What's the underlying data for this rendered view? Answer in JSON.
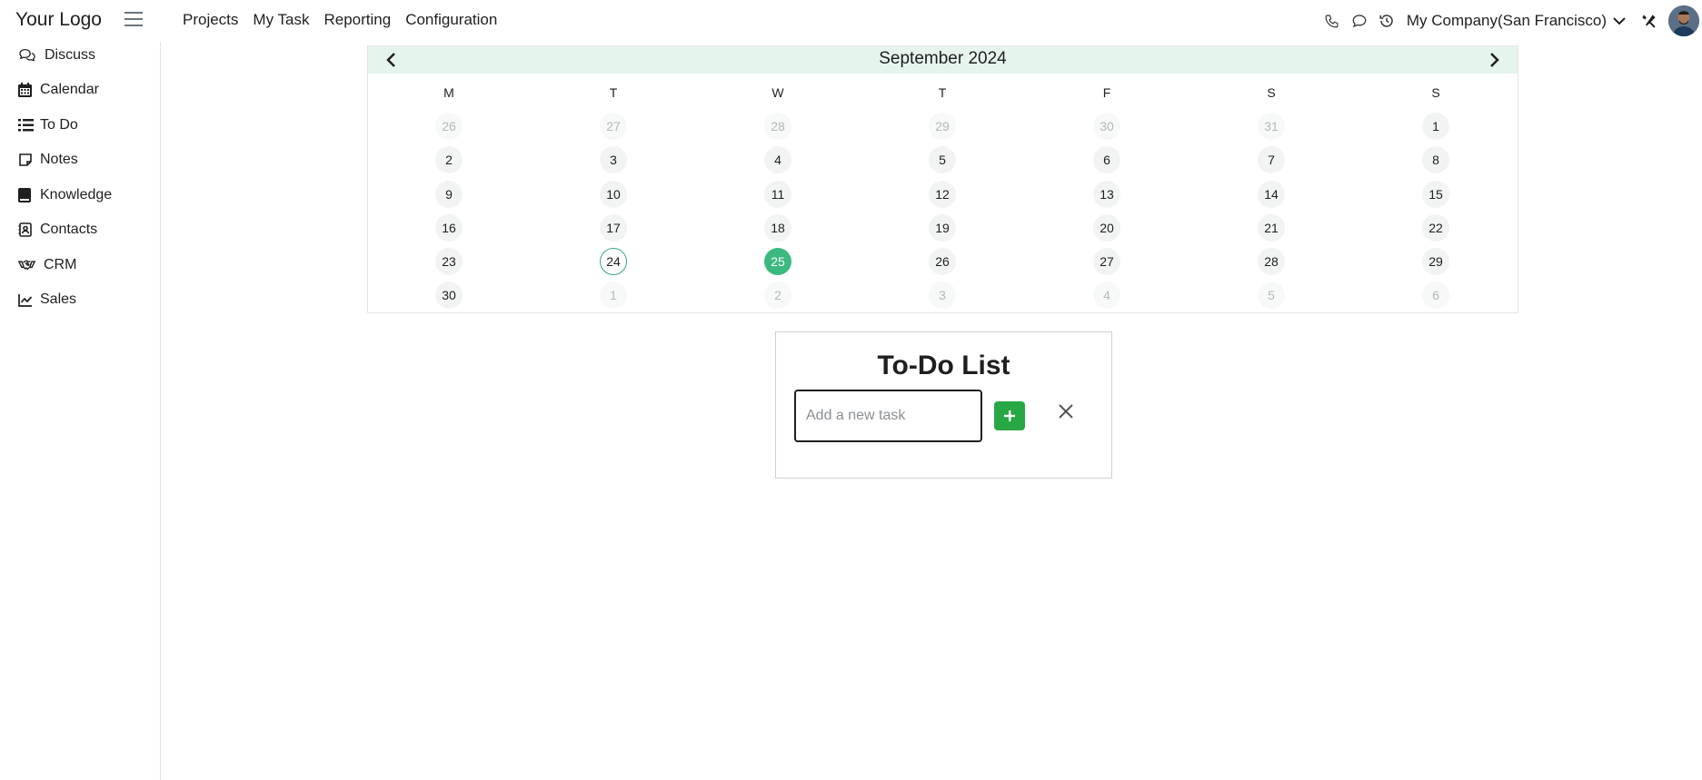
{
  "header": {
    "logo": "Your Logo",
    "nav": [
      "Projects",
      "My Task",
      "Reporting",
      "Configuration"
    ],
    "company": "My Company(San Francisco)",
    "icons": [
      "phone-icon",
      "chat-icon",
      "history-icon",
      "chevron-down-icon",
      "tools-icon",
      "avatar"
    ]
  },
  "sidebar": {
    "items": [
      {
        "label": "Discuss",
        "icon": "discuss-icon"
      },
      {
        "label": "Calendar",
        "icon": "calendar-icon"
      },
      {
        "label": "To Do",
        "icon": "list-icon"
      },
      {
        "label": "Notes",
        "icon": "note-icon"
      },
      {
        "label": "Knowledge",
        "icon": "book-icon"
      },
      {
        "label": "Contacts",
        "icon": "contact-card-icon"
      },
      {
        "label": "CRM",
        "icon": "handshake-icon"
      },
      {
        "label": "Sales",
        "icon": "line-chart-icon"
      }
    ]
  },
  "calendar": {
    "month_label": "September 2024",
    "weekdays": [
      "M",
      "T",
      "W",
      "T",
      "F",
      "S",
      "S"
    ],
    "weeks": [
      [
        "26",
        "27",
        "28",
        "29",
        "30",
        "31",
        "1"
      ],
      [
        "2",
        "3",
        "4",
        "5",
        "6",
        "7",
        "8"
      ],
      [
        "9",
        "10",
        "11",
        "12",
        "13",
        "14",
        "15"
      ],
      [
        "16",
        "17",
        "18",
        "19",
        "20",
        "21",
        "22"
      ],
      [
        "23",
        "24",
        "25",
        "26",
        "27",
        "28",
        "29"
      ],
      [
        "30",
        "1",
        "2",
        "3",
        "4",
        "5",
        "6"
      ]
    ],
    "today": "24",
    "selected": "25",
    "accent_color": "#3cb980",
    "header_bg": "#e6f4ee"
  },
  "todo": {
    "title": "To-Do List",
    "input_placeholder": "Add a new task",
    "input_value": "",
    "add_color": "#28a745"
  }
}
